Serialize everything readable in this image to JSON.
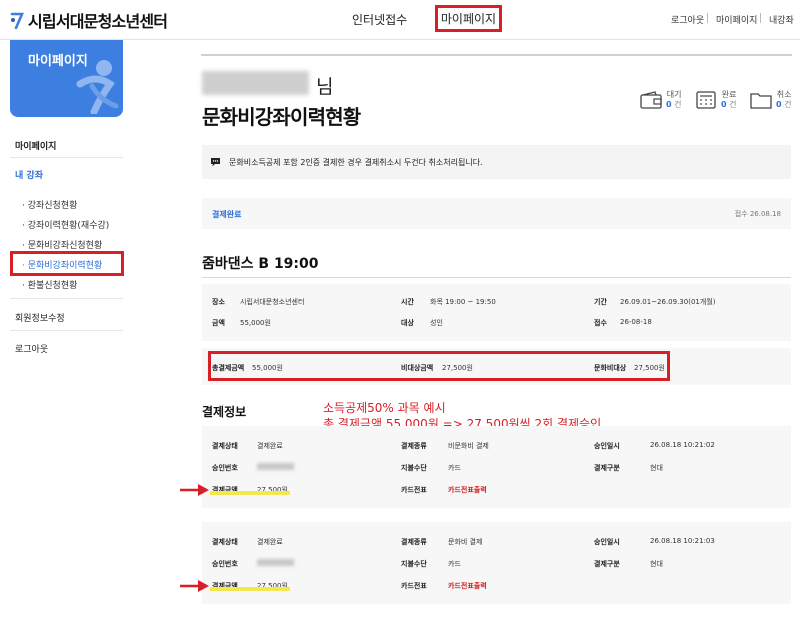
{
  "header": {
    "logo_text": "시립서대문청소년센터",
    "nav": {
      "internet": "인터넷접수",
      "mypage": "마이페이지"
    },
    "util": {
      "login": "로그아웃",
      "mypage": "마이페이지",
      "lecture": "내강좌"
    }
  },
  "sidebar": {
    "banner_title": "마이페이지",
    "mypage": "마이페이지",
    "my_lecture": "내 강좌",
    "sub_items": [
      "· 강좌신청현황",
      "· 강좌이력현황(재수강)",
      "· 문화비강좌신청현황",
      "· 문화비강좌이력현황",
      "· 환불신청현황"
    ],
    "member_edit": "회원정보수정",
    "logout": "로그아웃"
  },
  "main": {
    "user_suffix": "님",
    "page_title": "문화비강좌이력현황",
    "stats": [
      {
        "label": "대기",
        "count": "0",
        "unit": "건",
        "icon": "wallet-icon"
      },
      {
        "label": "완료",
        "count": "0",
        "unit": "건",
        "icon": "calculator-icon"
      },
      {
        "label": "취소",
        "count": "0",
        "unit": "건",
        "icon": "folder-icon"
      }
    ],
    "notice": "문화비소득공제 포함 2인증 결제한 경우 결제취소시 두건다 취소처리됩니다.",
    "status": {
      "label": "결제완료",
      "date": "접수 26.08.18"
    },
    "course": {
      "title": "줌바댄스 B 19:00",
      "place_label": "장소",
      "place": "시립서대문청소년센터",
      "time_label": "시간",
      "time": "화목 19:00 ~ 19:50",
      "period_label": "기간",
      "period": "26.09.01~26.09.30(01개월)",
      "amount_label": "금액",
      "amount": "55,000원",
      "target_label": "대상",
      "target": "성인",
      "reception_label": "접수",
      "reception": "26-08-18"
    },
    "summary": {
      "total_label": "총결제금액",
      "total": "55,000원",
      "non_label": "비대상금액",
      "non": "27,500원",
      "culture_label": "문화비대상",
      "culture": "27,500원"
    },
    "payment_title": "결제정보",
    "annotation": {
      "line1": "소득공제50% 과목 예시",
      "line2": "총 결제금액 55,000원 => 27,500원씩 2회 결제승인"
    },
    "payments": [
      {
        "status_label": "결제상태",
        "status": "결제완료",
        "type_label": "결제종류",
        "type": "비문화비 결제",
        "date_label": "승인일시",
        "date": "26.08.18 10:21:02",
        "approval_label": "승인번호",
        "method_label": "지불수단",
        "method": "카드",
        "installment_label": "결제구분",
        "installment": "현대",
        "amount_label": "결제금액",
        "amount": "27,500원",
        "receipt_label": "카드전표",
        "receipt": "카드전표출력"
      },
      {
        "status_label": "결제상태",
        "status": "결제완료",
        "type_label": "결제종류",
        "type": "문화비 결제",
        "date_label": "승인일시",
        "date": "26.08.18 10:21:03",
        "approval_label": "승인번호",
        "method_label": "지불수단",
        "method": "카드",
        "installment_label": "결제구분",
        "installment": "현대",
        "amount_label": "결제금액",
        "amount": "27,500원",
        "receipt_label": "카드전표",
        "receipt": "카드전표출력"
      }
    ]
  },
  "colors": {
    "accent_blue": "#2f6fd6",
    "highlight_red": "#d81f26",
    "banner_blue": "#3d7fe0"
  }
}
